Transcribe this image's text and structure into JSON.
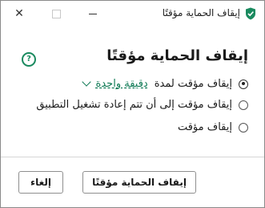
{
  "window": {
    "title": "إيقاف الحماية مؤقتًا",
    "controls": {
      "minimize": "minimize",
      "maximize": "maximize",
      "close": "✕"
    }
  },
  "dialog": {
    "heading": "إيقاف الحماية مؤقتًا",
    "help_icon": "?",
    "options": [
      {
        "label": "إيقاف مؤقت لمدة",
        "checked": true,
        "duration_value": "دقيقة واحدة"
      },
      {
        "label": "إيقاف مؤقت إلى أن تتم إعادة تشغيل التطبيق",
        "checked": false
      },
      {
        "label": "إيقاف مؤقت",
        "checked": false
      }
    ]
  },
  "footer": {
    "stop_button": "إيقاف الحماية مؤقتًا",
    "cancel_button": "إلغاء"
  },
  "colors": {
    "accent": "#0f7a55",
    "help_icon": "#1a8a5f"
  }
}
